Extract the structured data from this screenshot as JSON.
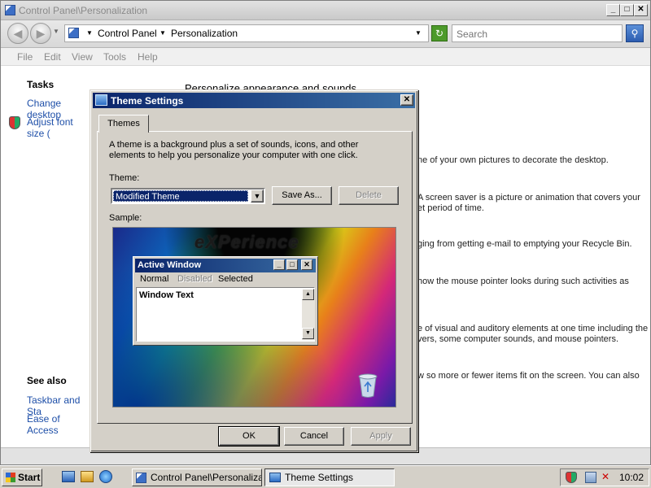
{
  "window": {
    "title": "Control Panel\\Personalization",
    "caption": {
      "minimize": "_",
      "maximize": "□",
      "close": "✕"
    }
  },
  "address": {
    "breadcrumb": [
      "Control Panel",
      "Personalization"
    ],
    "separator": "▸",
    "search_placeholder": "Search"
  },
  "menu": [
    "File",
    "Edit",
    "View",
    "Tools",
    "Help"
  ],
  "left_pane": {
    "tasks_heading": "Tasks",
    "tasks": [
      "Change desktop",
      "Adjust font size ("
    ],
    "see_also_heading": "See also",
    "see_also": [
      "Taskbar and Sta",
      "Ease of Access"
    ]
  },
  "content": {
    "heading": "Personalize appearance and sounds",
    "fragments": [
      "ne of your own pictures to decorate the desktop.",
      "A screen saver is a picture or animation that covers your",
      "et period of time.",
      "ging from getting e-mail to emptying your Recycle Bin.",
      "how the mouse pointer looks during such activities as",
      "e of visual and auditory elements at one time including the",
      "vers, some computer sounds, and mouse pointers.",
      "w so more or fewer items fit on the screen. You can also"
    ]
  },
  "dialog": {
    "title": "Theme Settings",
    "close": "✕",
    "tab": "Themes",
    "description": "A theme is a background plus a set of sounds, icons, and other elements to help you personalize your computer with one click.",
    "theme_label": "Theme:",
    "theme_value": "Modified Theme",
    "save_as": "Save As...",
    "delete": "Delete",
    "sample_label": "Sample:",
    "ok": "OK",
    "cancel": "Cancel",
    "apply": "Apply",
    "preview": {
      "watermark": "eXPerience",
      "window_title": "Active Window",
      "menu_normal": "Normal",
      "menu_disabled": "Disabled",
      "menu_selected": "Selected",
      "window_text": "Window Text"
    }
  },
  "taskbar": {
    "start": "Start",
    "tasks": [
      "Control Panel\\Personaliza...",
      "Theme Settings"
    ],
    "clock": "10:02"
  },
  "colors": {
    "titlebar_active": "#0a246a",
    "face": "#d4d0c8",
    "link": "#1e4fa8"
  }
}
